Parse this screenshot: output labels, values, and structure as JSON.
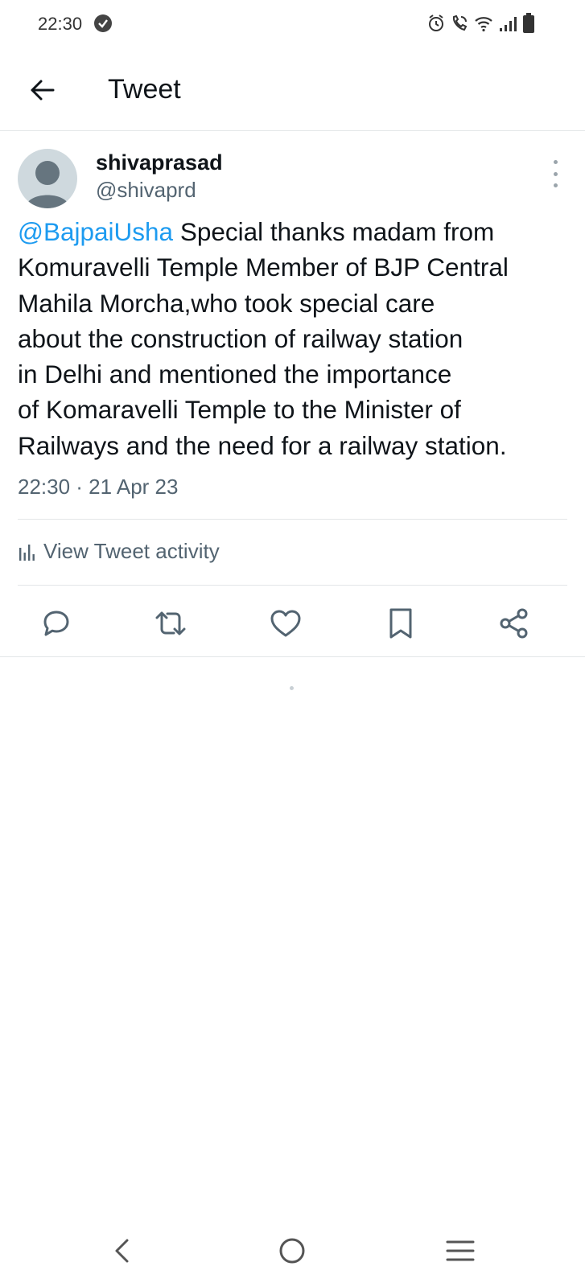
{
  "status_bar": {
    "time": "22:30",
    "icons": [
      "check-circle-icon",
      "alarm-icon",
      "wifi-calling-icon",
      "wifi-icon",
      "signal-icon",
      "battery-icon"
    ]
  },
  "header": {
    "back_icon": "arrow-left-icon",
    "title": "Tweet"
  },
  "tweet": {
    "display_name": "shivaprasad",
    "handle": "@shivaprd",
    "mention": "@BajpaiUsha",
    "lines": [
      " Special thanks madam from",
      "Komuravelli Temple Member of BJP Central",
      "Mahila Morcha,who took special care",
      "about the construction of railway station",
      "in Delhi and mentioned the importance",
      "of Komaravelli Temple to the Minister of",
      "Railways and the need for a railway station."
    ],
    "timestamp": "22:30 · 21 Apr 23",
    "activity_label": "View Tweet activity"
  },
  "actions": [
    "reply-icon",
    "retweet-icon",
    "like-icon",
    "bookmark-icon",
    "share-icon"
  ],
  "colors": {
    "link": "#1d9bf0",
    "secondary_text": "#536471",
    "primary_text": "#0f1419",
    "divider": "#e3e6e8"
  },
  "nav_bar": [
    "back-nav-icon",
    "home-nav-icon",
    "recents-nav-icon"
  ]
}
